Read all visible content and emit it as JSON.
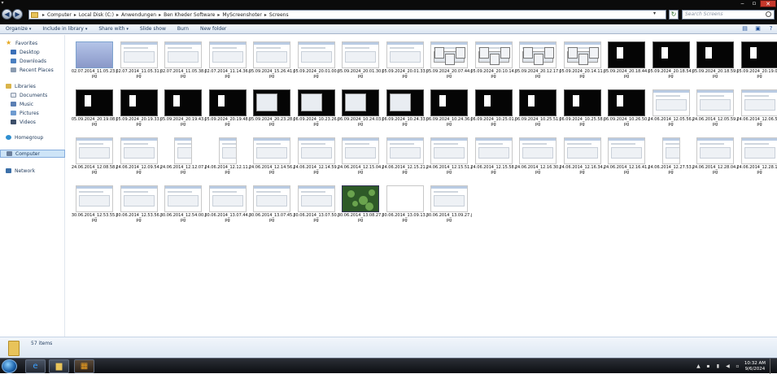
{
  "address": {
    "crumbs": [
      "Computer",
      "Local Disk (C:)",
      "Anwendungen",
      "Ben Kheder Software",
      "MyScreenshoter",
      "Screens"
    ],
    "search_placeholder": "Search Screens"
  },
  "toolbar": {
    "organize": "Organize",
    "include": "Include in library",
    "share": "Share with",
    "slideshow": "Slide show",
    "burn": "Burn",
    "newfolder": "New folder"
  },
  "nav": {
    "favorites": "Favorites",
    "desktop": "Desktop",
    "downloads": "Downloads",
    "recent": "Recent Places",
    "libraries": "Libraries",
    "documents": "Documents",
    "music": "Music",
    "pictures": "Pictures",
    "videos": "Videos",
    "homegroup": "Homegroup",
    "computer": "Computer",
    "network": "Network"
  },
  "files": [
    {
      "name": "02.07.2014_11.05.23.jpg",
      "style": "sel"
    },
    {
      "name": "02.07.2014_11.05.31.jpg",
      "style": "light"
    },
    {
      "name": "02.07.2014_11.05.38.jpg",
      "style": "light"
    },
    {
      "name": "02.07.2014_11.14.36.jpg",
      "style": "light"
    },
    {
      "name": "05.09.2024_15.26.41.jpg",
      "style": "light"
    },
    {
      "name": "05.09.2024_20.01.00.jpg",
      "style": "light"
    },
    {
      "name": "05.09.2024_20.01.30.jpg",
      "style": "light"
    },
    {
      "name": "05.09.2024_20.01.33.jpg",
      "style": "light"
    },
    {
      "name": "05.09.2024_20.07.44.jpg",
      "style": "multi"
    },
    {
      "name": "05.09.2024_20.10.14.jpg",
      "style": "multi"
    },
    {
      "name": "05.09.2024_20.12.17.jpg",
      "style": "multi"
    },
    {
      "name": "05.09.2024_20.14.11.jpg",
      "style": "multi"
    },
    {
      "name": "05.09.2024_20.18.44.jpg",
      "style": "dark"
    },
    {
      "name": "05.09.2024_20.18.54.jpg",
      "style": "dark"
    },
    {
      "name": "05.09.2024_20.18.59.jpg",
      "style": "dark"
    },
    {
      "name": "05.09.2024_20.19.04.jpg",
      "style": "dark"
    },
    {
      "name": "05.09.2024_20.19.08.jpg",
      "style": "dark"
    },
    {
      "name": "05.09.2024_20.19.33.jpg",
      "style": "dark"
    },
    {
      "name": "05.09.2024_20.19.43.jpg",
      "style": "dark"
    },
    {
      "name": "05.09.2024_20.19.48.jpg",
      "style": "dark"
    },
    {
      "name": "05.09.2024_20.23.28.jpg",
      "style": "darkwin"
    },
    {
      "name": "06.09.2024_10.23.26.jpg",
      "style": "darkwin"
    },
    {
      "name": "06.09.2024_10.24.03.jpg",
      "style": "darkwin"
    },
    {
      "name": "06.09.2024_10.24.33.jpg",
      "style": "darkwin"
    },
    {
      "name": "06.09.2024_10.24.36.jpg",
      "style": "dark"
    },
    {
      "name": "06.09.2024_10.25.01.jpg",
      "style": "dark"
    },
    {
      "name": "06.09.2024_10.25.51.jpg",
      "style": "dark"
    },
    {
      "name": "06.09.2024_10.25.58.jpg",
      "style": "dark"
    },
    {
      "name": "06.09.2024_10.26.50.jpg",
      "style": "dark"
    },
    {
      "name": "24.06.2014_12.05.56.jpg",
      "style": "light"
    },
    {
      "name": "24.06.2014_12.05.59.jpg",
      "style": "light"
    },
    {
      "name": "24.06.2014_12.06.57.jpg",
      "style": "light"
    },
    {
      "name": "24.06.2014_12.08.58.jpg",
      "style": "light"
    },
    {
      "name": "24.06.2014_12.09.54.jpg",
      "style": "light"
    },
    {
      "name": "24.06.2014_12.12.07.jpg",
      "style": "tall"
    },
    {
      "name": "24.06.2014_12.12.11.jpg",
      "style": "tall"
    },
    {
      "name": "24.06.2014_12.14.56.jpg",
      "style": "light"
    },
    {
      "name": "24.06.2014_12.14.59.jpg",
      "style": "light"
    },
    {
      "name": "24.06.2014_12.15.04.jpg",
      "style": "light"
    },
    {
      "name": "24.06.2014_12.15.21.jpg",
      "style": "light"
    },
    {
      "name": "24.06.2014_12.15.51.jpg",
      "style": "light"
    },
    {
      "name": "24.06.2014_12.15.58.jpg",
      "style": "light"
    },
    {
      "name": "24.06.2014_12.16.30.jpg",
      "style": "light"
    },
    {
      "name": "24.06.2014_12.16.34.jpg",
      "style": "light"
    },
    {
      "name": "24.06.2014_12.16.41.jpg",
      "style": "light"
    },
    {
      "name": "24.06.2014_12.27.53.jpg",
      "style": "tall"
    },
    {
      "name": "24.06.2014_12.28.04.jpg",
      "style": "light"
    },
    {
      "name": "24.06.2014_12.28.13.jpg",
      "style": "light"
    },
    {
      "name": "30.06.2014_12.53.55.jpg",
      "style": "light"
    },
    {
      "name": "30.06.2014_12.53.56.jpg",
      "style": "light"
    },
    {
      "name": "30.06.2014_12.54.00.jpg",
      "style": "light"
    },
    {
      "name": "30.06.2014_13.07.44.jpg",
      "style": "light"
    },
    {
      "name": "30.06.2014_13.07.45.jpg",
      "style": "light"
    },
    {
      "name": "30.06.2014_13.07.50.jpg",
      "style": "light"
    },
    {
      "name": "30.06.2014_13.08.27.jpg",
      "style": "green"
    },
    {
      "name": "30.06.2014_13.09.13.jpg",
      "style": "blank"
    },
    {
      "name": "30.06.2014_13.09.27.jpg",
      "style": "light"
    }
  ],
  "status": {
    "count": "57 items"
  },
  "clock": {
    "time": "10:32 AM",
    "date": "9/6/2024"
  },
  "icons": {
    "back": "back-arrow-icon",
    "forward": "forward-arrow-icon",
    "refresh": "refresh-icon",
    "search": "search-icon",
    "help": "help-icon"
  }
}
